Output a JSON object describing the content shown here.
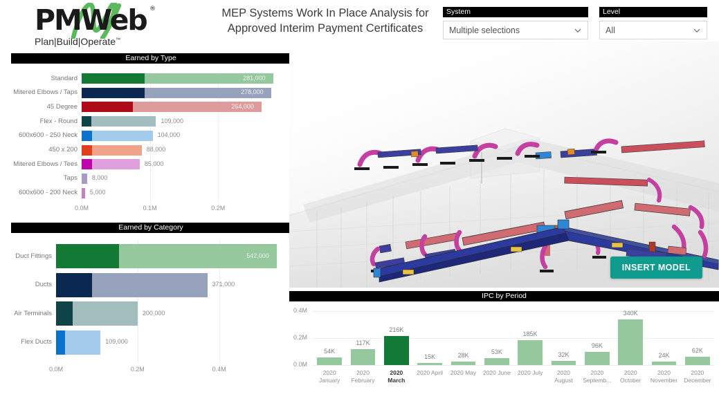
{
  "brand": {
    "logo_text": "PMWeb",
    "logo_registered": "®",
    "tagline": "Plan|Build|Operate",
    "tagline_tm": "™"
  },
  "header": {
    "title_line1": "MEP Systems Work In Place Analysis for",
    "title_line2": "Approved Interim Payment Certificates"
  },
  "filters": [
    {
      "label": "System",
      "value": "Multiple selections",
      "icon": "chevron-down-icon"
    },
    {
      "label": "Level",
      "value": "All",
      "icon": "chevron-down-icon"
    }
  ],
  "viewer": {
    "title": "3d-model-viewer",
    "insert_button": "INSERT MODEL"
  },
  "panels": {
    "earned_by_type": "Earned by Type",
    "earned_by_category": "Earned by Category",
    "ipc_by_period": "IPC by Period"
  },
  "chart_data": [
    {
      "type": "bar",
      "orientation": "horizontal",
      "title": "Earned by Type",
      "xlabel": "",
      "ylabel": "",
      "xlim": [
        0,
        0.29
      ],
      "ticks": [
        "0.0M",
        "0.1M",
        "0.2M"
      ],
      "tick_values": [
        0,
        100000,
        200000
      ],
      "grid": true,
      "legend": null,
      "categories": [
        "Standard",
        "Mitered Elbows / Taps",
        "45 Degree",
        "Flex - Round",
        "600x600 - 250 Neck",
        "450 x 200",
        "Mitered Elbows / Tees",
        "Taps",
        "600x600 - 200 Neck"
      ],
      "values": [
        281000,
        278000,
        264000,
        109000,
        104000,
        88000,
        85000,
        8000,
        5000
      ],
      "value_labels": [
        "281,000",
        "278,000",
        "264,000",
        "109,000",
        "104,000",
        "88,000",
        "85,000",
        "8,000",
        "5,000"
      ],
      "dark_segment_values": [
        92000,
        92000,
        75000,
        14000,
        15000,
        15000,
        15000,
        0,
        0
      ],
      "colors_dark": [
        "#137a36",
        "#0b2850",
        "#ae0a18",
        "#0e4347",
        "#0d72cc",
        "#e0401c",
        "#bf05ad",
        "#a99ac4",
        "#c87ebf"
      ],
      "colors_light": [
        "#95c89c",
        "#97a3bd",
        "#dd9b9b",
        "#a3bcbd",
        "#a3ccec",
        "#f0a389",
        "#e0a0dd",
        "#a99ac4",
        "#c87ebf"
      ]
    },
    {
      "type": "bar",
      "orientation": "horizontal",
      "title": "Earned by Category",
      "xlabel": "",
      "ylabel": "",
      "xlim": [
        0,
        0.55
      ],
      "ticks": [
        "0.0M",
        "0.2M",
        "0.4M"
      ],
      "tick_values": [
        0,
        200000,
        400000
      ],
      "grid": true,
      "legend": null,
      "categories": [
        "Duct Fittings",
        "Ducts",
        "Air Terminals",
        "Flex Ducts"
      ],
      "values": [
        542000,
        371000,
        200000,
        109000
      ],
      "value_labels": [
        "542,000",
        "371,000",
        "200,000",
        "109,000"
      ],
      "dark_segment_values": [
        155000,
        88000,
        40000,
        22000
      ],
      "colors_dark": [
        "#137a36",
        "#0b2850",
        "#0e4347",
        "#0d72cc"
      ],
      "colors_light": [
        "#95c89c",
        "#97a3bd",
        "#a3bcbd",
        "#a3ccec"
      ]
    },
    {
      "type": "bar",
      "orientation": "vertical",
      "title": "IPC by Period",
      "xlabel": "",
      "ylabel": "",
      "ylim": [
        0,
        400000
      ],
      "yticks": [
        "0.0M",
        "0.2M",
        "0.4M"
      ],
      "ytick_values": [
        0,
        200000,
        400000
      ],
      "grid": true,
      "legend": null,
      "selected_category": "2020 March",
      "bar_color": "#95c89c",
      "bar_color_selected": "#137a36",
      "categories": [
        "2020\nJanuary",
        "2020\nFebruary",
        "2020\nMarch",
        "2020 April",
        "2020 May",
        "2020 June",
        "2020 July",
        "2020\nAugust",
        "2020\nSeptemb...",
        "2020\nOctober",
        "2020\nNovember",
        "2020\nDecember"
      ],
      "values": [
        54000,
        117000,
        216000,
        15000,
        28000,
        53000,
        185000,
        32000,
        96000,
        340000,
        24000,
        62000
      ],
      "value_labels": [
        "54K",
        "117K",
        "216K",
        "15K",
        "28K",
        "53K",
        "185K",
        "32K",
        "96K",
        "340K",
        "24K",
        "62K"
      ]
    }
  ]
}
